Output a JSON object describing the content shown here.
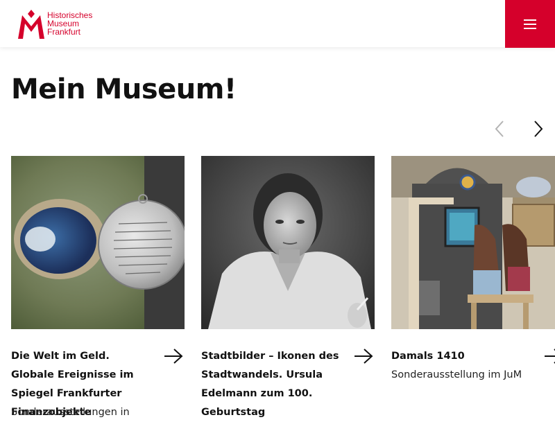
{
  "header": {
    "logo_lines": [
      "Historisches",
      "Museum",
      "Frankfurt"
    ],
    "brand_color": "#d5002b",
    "menu_icon": "hamburger-menu-icon"
  },
  "main": {
    "title": "Mein Museum!",
    "carousel_prev_icon": "chevron-left-icon",
    "carousel_next_icon": "chevron-right-icon",
    "cards": [
      {
        "title": "Die Welt im Geld. Globale Ereignisse im Spiegel Frankfurter Finanzobjekte",
        "subtitle": "Sonderausstellungen in",
        "image": "medal-and-volcano-crater-photo",
        "arrow_icon": "arrow-right-icon"
      },
      {
        "title": "Stadtbilder – Ikonen des Stadtwandels. Ursula Edelmann zum 100. Geburtstag",
        "subtitle": "",
        "image": "black-and-white-portrait-photo",
        "arrow_icon": "arrow-right-icon"
      },
      {
        "title": "Damals 1410",
        "subtitle": "Sonderausstellung im JuM",
        "image": "children-at-interactive-exhibit-photo",
        "arrow_icon": "arrow-right-icon"
      }
    ]
  }
}
